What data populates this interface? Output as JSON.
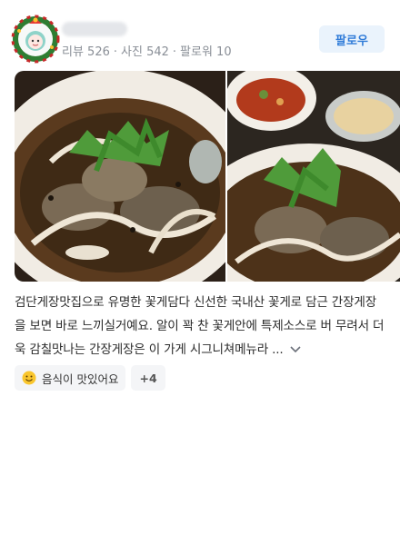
{
  "header": {
    "stats": {
      "reviews": "리뷰 526",
      "photos": "사진 542",
      "followers": "팔로워 10",
      "separator": "·"
    },
    "follow_label": "팔로우"
  },
  "review": {
    "text": "검단게장맛집으로 유명한 꽃게담다 신선한 국내산 꽃게로 담근 간장게장을 보면 바로 느끼실거예요. 알이 꽉 찬 꽃게안에 특제소스로 버 무려서 더욱 감칠맛나는 간장게장은 이 가게 시그니쳐메뉴라 ..."
  },
  "tags": {
    "items": [
      {
        "label": "음식이 맛있어요",
        "icon": "smile-emoji-icon"
      }
    ],
    "more_label": "+4"
  },
  "colors": {
    "accent": "#2f7bd8",
    "follow_bg": "#eaf3fc",
    "tag_bg": "#f4f5f7",
    "stats": "#8a8f97"
  }
}
